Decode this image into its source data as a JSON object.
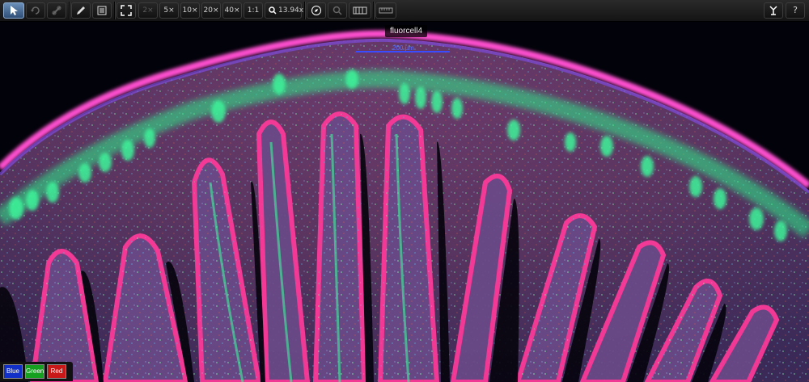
{
  "toolbar": {
    "tools": [
      {
        "name": "select-arrow-icon",
        "active": true
      },
      {
        "name": "rotate-icon"
      },
      {
        "name": "link-icon"
      },
      {
        "name": "annotate-pen-icon"
      },
      {
        "name": "layers-list-icon"
      },
      {
        "name": "fit-to-screen-icon"
      }
    ],
    "zoom_presets": [
      "2×",
      "5×",
      "10×",
      "20×",
      "40×",
      "1:1"
    ],
    "zoom_value": "13.94x",
    "right_tools": [
      "navigator-icon",
      "search-icon",
      "filmstrip-icon",
      "ruler-icon"
    ],
    "help_label": "?"
  },
  "viewer": {
    "image_title": "fluorcell4",
    "scale_label": "200 µm"
  },
  "channels": [
    {
      "label": "Blue",
      "color": "#1030c8"
    },
    {
      "label": "Green",
      "color": "#15a020"
    },
    {
      "label": "Red",
      "color": "#c81818"
    }
  ]
}
